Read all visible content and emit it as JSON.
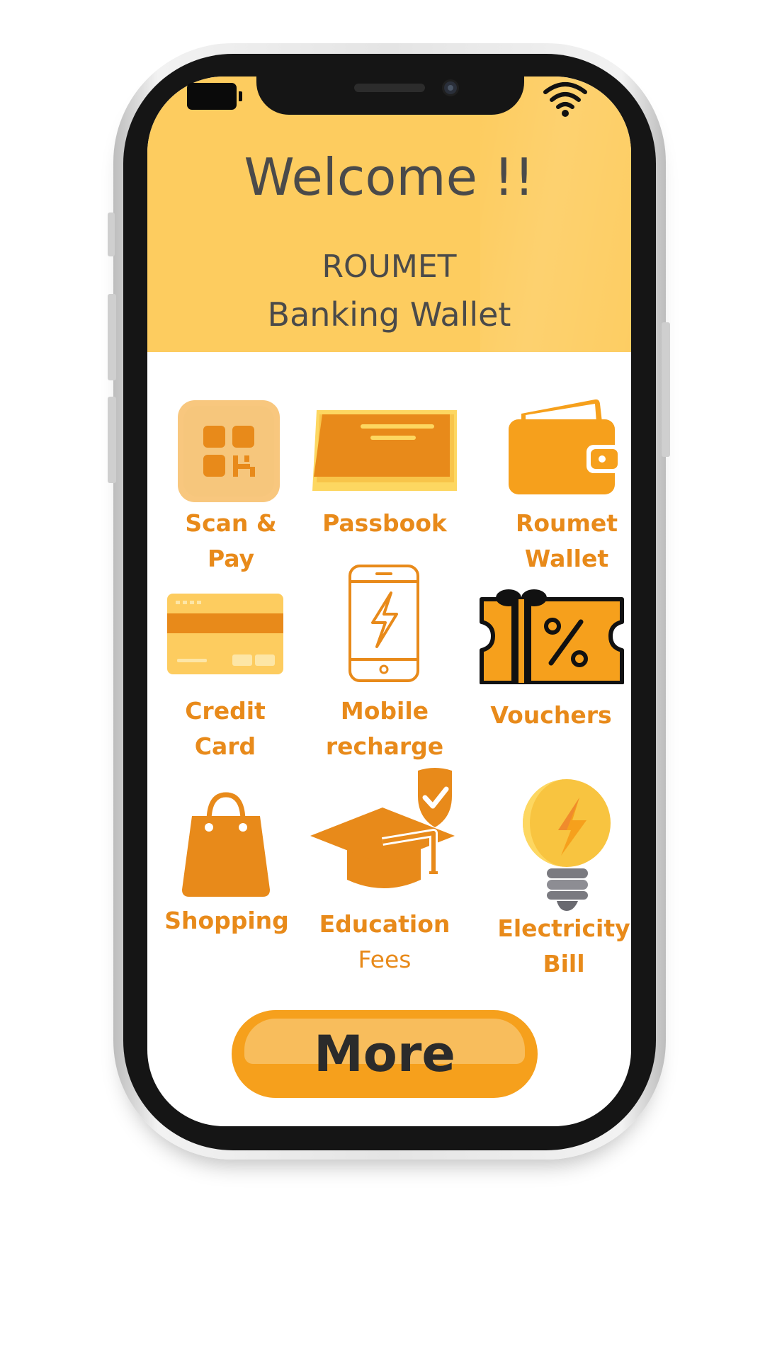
{
  "header": {
    "welcome": "Welcome !!",
    "brand": "ROUMET",
    "subtitle": "Banking Wallet"
  },
  "status_bar": {
    "battery_icon": "battery-icon",
    "wifi_icon": "wifi-icon"
  },
  "services": [
    {
      "icon": "qr-code-icon",
      "line1": "Scan &",
      "line2": "Pay"
    },
    {
      "icon": "passbook-icon",
      "line1": "Passbook",
      "line2": ""
    },
    {
      "icon": "wallet-icon",
      "line1": "Roumet",
      "line2": "Wallet"
    },
    {
      "icon": "credit-card-icon",
      "line1": "Credit",
      "line2": "Card"
    },
    {
      "icon": "mobile-recharge-icon",
      "line1": "Mobile",
      "line2": "recharge"
    },
    {
      "icon": "voucher-icon",
      "line1": "Vouchers",
      "line2": ""
    },
    {
      "icon": "shopping-bag-icon",
      "line1": "Shopping",
      "line2": ""
    },
    {
      "icon": "graduation-cap-icon",
      "line1": "Education",
      "line2": "Fees"
    },
    {
      "icon": "light-bulb-icon",
      "line1": "Electricity",
      "line2": "Bill"
    }
  ],
  "more_button": {
    "label": "More"
  },
  "colors": {
    "header_bg": "#fdcc5f",
    "accent": "#e88a1a",
    "text_dark": "#4a4a4a",
    "button": "#f6a01c"
  }
}
